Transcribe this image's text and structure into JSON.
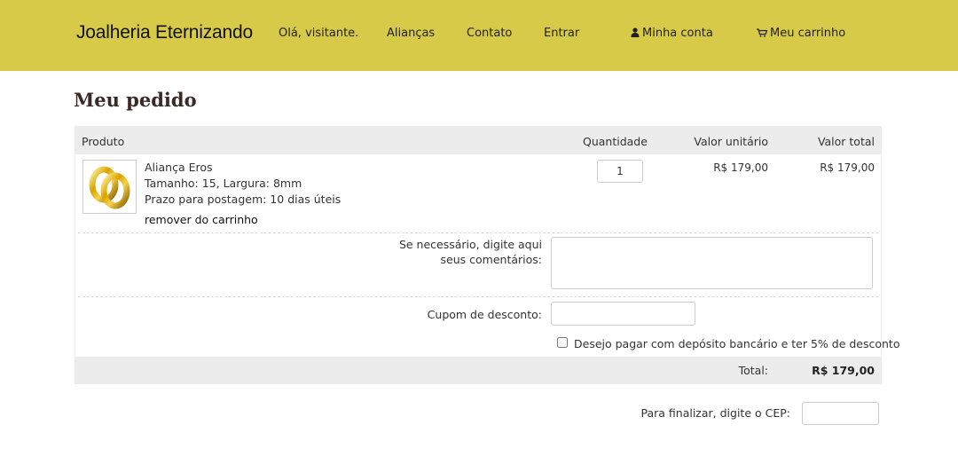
{
  "header": {
    "brand": "Joalheria Eternizando",
    "greeting": "Olá, visitante.",
    "nav": {
      "aliancas": "Alianças",
      "contato": "Contato",
      "entrar": "Entrar",
      "minha_conta": "Minha conta",
      "meu_carrinho": "Meu carrinho"
    },
    "icons": {
      "account": "user-icon",
      "cart": "cart-icon"
    },
    "background_color": "#d7ca49"
  },
  "page": {
    "title": "Meu pedido"
  },
  "cart": {
    "columns": {
      "produto": "Produto",
      "quantidade": "Quantidade",
      "valor_unitario": "Valor unitário",
      "valor_total": "Valor total"
    },
    "items": [
      {
        "name": "Aliança Eros",
        "details": "Tamanho: 15, Largura: 8mm",
        "shipping": "Prazo para postagem: 10 dias úteis",
        "remove_label": "remover do carrinho",
        "quantity": "1",
        "unit_price": "R$ 179,00",
        "total_price": "R$ 179,00"
      }
    ],
    "comments": {
      "label_line1": "Se necessário, digite aqui",
      "label_line2": "seus comentários:",
      "value": ""
    },
    "coupon": {
      "label": "Cupom de desconto:",
      "value": ""
    },
    "deposit": {
      "label": "Desejo pagar com depósito bancário e ter 5% de desconto",
      "checked": false
    },
    "total": {
      "label": "Total:",
      "value": "R$ 179,00"
    }
  },
  "checkout": {
    "cep_label": "Para finalizar, digite o CEP:",
    "cep_value": ""
  }
}
